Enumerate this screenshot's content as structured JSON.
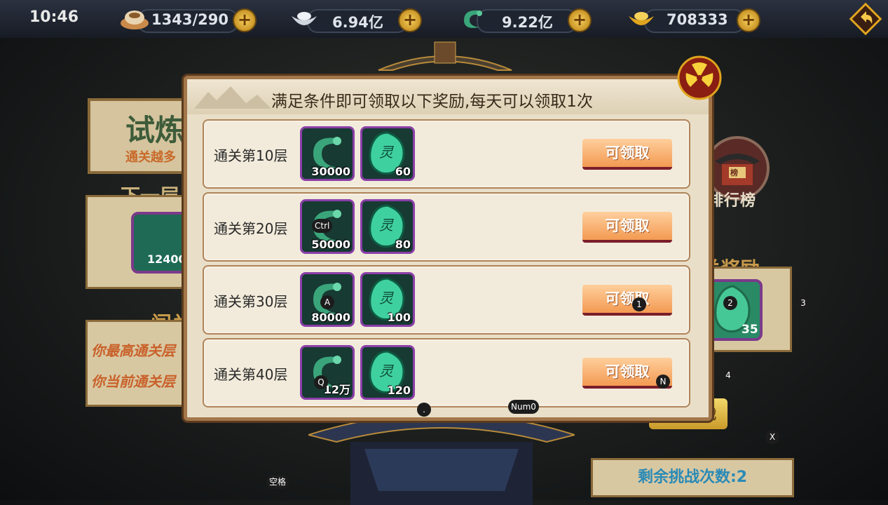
{
  "topbar": {
    "time": "10:46",
    "stamina": "1343/290",
    "silver": "6.94亿",
    "jade": "9.22亿",
    "gold": "708333"
  },
  "background": {
    "title_partial": "试炼",
    "title_sub_partial": "通关越多",
    "next_layer_partial": "下一层",
    "next_item_count_partial": "12400",
    "bottom_label_partial": "闯关",
    "bottom_line1_partial": "你最高通关层",
    "bottom_line2_partial": "你当前通关层",
    "ranking_label": "排行榜",
    "ranking_sign": "榜",
    "reward_label_partial": "关奖励",
    "reward_item_count": "35",
    "start_button_partial": "开始挑战",
    "remaining_challenges": "剩余挑战次数:2"
  },
  "dialog": {
    "title": "满足条件即可领取以下奖励,每天可以领取1次",
    "rows": [
      {
        "label": "通关第10层",
        "reward1": "30000",
        "reward2": "60",
        "button": "可领取"
      },
      {
        "label": "通关第20层",
        "reward1": "50000",
        "reward2": "80",
        "button": "可领取"
      },
      {
        "label": "通关第30层",
        "reward1": "80000",
        "reward2": "100",
        "button": "可领取"
      },
      {
        "label": "通关第40层",
        "reward1": "12万",
        "reward2": "120",
        "button": "可领取"
      }
    ],
    "item_glyph": "灵"
  },
  "key_hints": {
    "ctrl": "Ctrl",
    "a": "A",
    "q": "Q",
    "one": "1",
    "two": "2",
    "three": "3",
    "four": "4",
    "n": "N",
    "dot": ".",
    "num0": "Num0",
    "x": "X",
    "space": "空格"
  },
  "colors": {
    "dialog_bg": "#e9dfc9",
    "dialog_border": "#a3774a",
    "item_border": "#8a3fa8",
    "claim_button": "#f39a52"
  }
}
